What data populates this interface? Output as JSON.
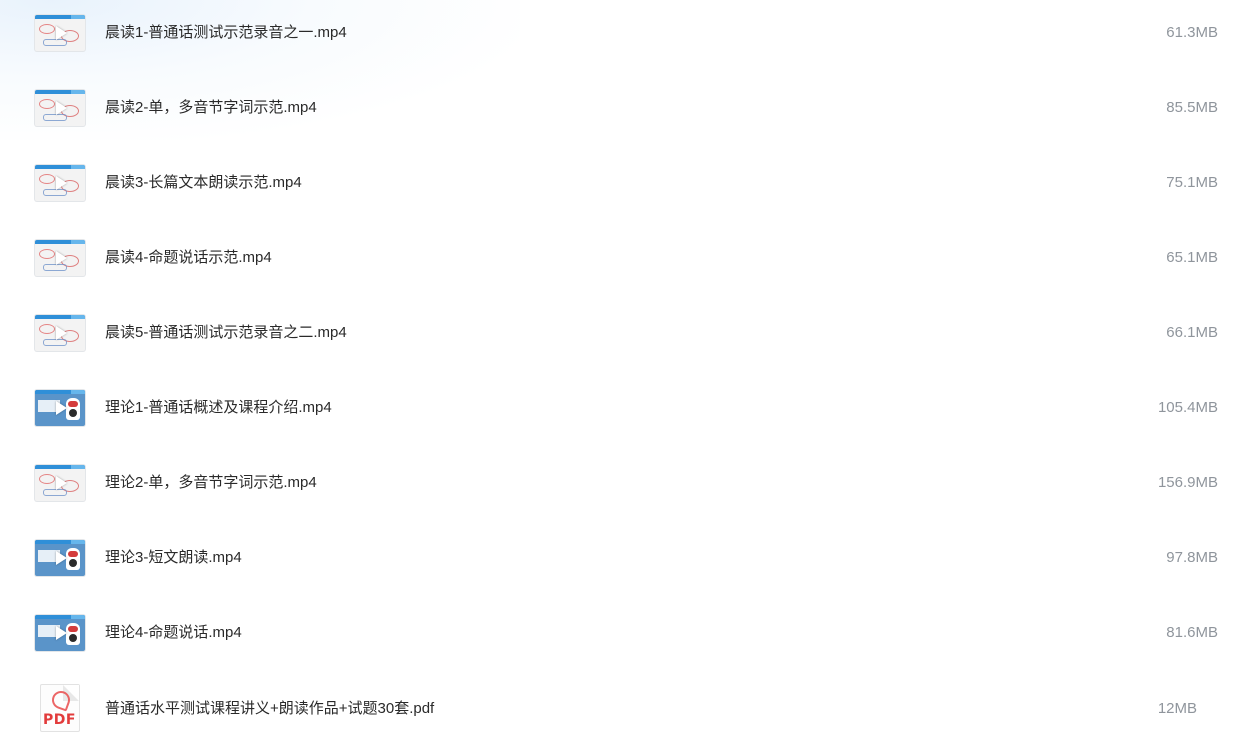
{
  "files": [
    {
      "name": "晨读1-普通话测试示范录音之一.mp4",
      "size": "61.3MB",
      "icon": "video-thumbnail-icon",
      "type": "mp4"
    },
    {
      "name": "晨读2-单，多音节字词示范.mp4",
      "size": "85.5MB",
      "icon": "video-thumbnail-icon",
      "type": "mp4"
    },
    {
      "name": "晨读3-长篇文本朗读示范.mp4",
      "size": "75.1MB",
      "icon": "video-thumbnail-icon",
      "type": "mp4"
    },
    {
      "name": "晨读4-命题说话示范.mp4",
      "size": "65.1MB",
      "icon": "video-thumbnail-icon",
      "type": "mp4"
    },
    {
      "name": "晨读5-普通话测试示范录音之二.mp4",
      "size": "66.1MB",
      "icon": "video-thumbnail-icon",
      "type": "mp4"
    },
    {
      "name": "理论1-普通话概述及课程介绍.mp4",
      "size": "105.4MB",
      "icon": "video-thumbnail-icon",
      "type": "mp4"
    },
    {
      "name": "理论2-单，多音节字词示范.mp4",
      "size": "156.9MB",
      "icon": "video-thumbnail-icon",
      "type": "mp4"
    },
    {
      "name": "理论3-短文朗读.mp4",
      "size": "97.8MB",
      "icon": "video-thumbnail-icon",
      "type": "mp4"
    },
    {
      "name": "理论4-命题说话.mp4",
      "size": "81.6MB",
      "icon": "video-thumbnail-icon",
      "type": "mp4"
    },
    {
      "name": "普通话水平测试课程讲义+朗读作品+试题30套.pdf",
      "size": "12MB",
      "icon": "pdf-file-icon",
      "type": "pdf"
    }
  ],
  "colors": {
    "name_text": "#2a2a2a",
    "size_text": "#8f959c",
    "thumb_accent": "#2f8fd8",
    "pdf_red": "#e23b3b"
  },
  "pdf_icon_text": "PDF"
}
